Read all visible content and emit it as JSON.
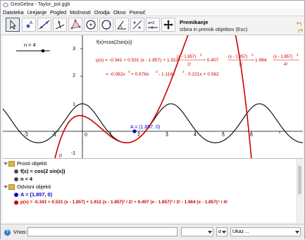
{
  "window": {
    "title": "GeoGebra - Taylor_pol.ggb"
  },
  "menu": [
    "Datoteka",
    "Urejanje",
    "Pogled",
    "Možnosti",
    "Orodja",
    "Okno",
    "Pomoč"
  ],
  "tool_info": {
    "name": "Premikanje",
    "help": "Izbira in premik objektov (Esc)"
  },
  "tools": [
    {
      "name": "move-tool",
      "active": true
    },
    {
      "name": "new-point-tool"
    },
    {
      "name": "line-tool"
    },
    {
      "name": "perpendicular-line-tool"
    },
    {
      "name": "polygon-tool"
    },
    {
      "name": "circle-tool"
    },
    {
      "name": "circle-three-points-tool"
    },
    {
      "name": "angle-tool"
    },
    {
      "name": "reflect-tool"
    },
    {
      "name": "slider-tool",
      "text": "a=2"
    },
    {
      "name": "move-graphics-view-tool"
    }
  ],
  "graphics": {
    "slider": {
      "label": "n = 4",
      "value": 4
    },
    "f_label": "f(x)=cos(2sin(x))",
    "p_formula": {
      "lead": "p(x) = -0.341 + 0.531 (x - 1.857) + 1.912 ",
      "t2_num": "(x - 1.857)",
      "t2_den": "2!",
      "plus": " + 0.407 ",
      "t3_num": "(x - 1.857)",
      "t3_den": "3!",
      "minus": " - 1.964 ",
      "t4_num": "(x - 1.857)",
      "t4_den": "4!",
      "exp2": "2",
      "exp3": "3",
      "exp4": "4",
      "expanded": "= -0.082x",
      "e4": "4",
      "expanded_b": " + 0.676x",
      "e3": "3",
      "expanded_c": " - 1.116x",
      "e2": "2",
      "expanded_d": " - 0.221x + 0.562"
    },
    "point_label": "A = (1.857, 0)",
    "p_label": "p",
    "y_ticks": [
      "3",
      "2",
      "1",
      "-1"
    ],
    "x_ticks": [
      "-2",
      "-1",
      "0",
      "1",
      "2",
      "3",
      "4",
      "5",
      "6"
    ],
    "colors": {
      "f": "#000000",
      "p": "#cc0000",
      "point": "#0000cc"
    }
  },
  "algebra": {
    "free_header": "Prosti objekti",
    "free_items": [
      "f(x) = cos(2 sin(x))",
      "n = 4"
    ],
    "dependent_header": "Odvisni objekti",
    "dependent_items": [
      "A = (1.857, 0)",
      "p(x) = -0.341 + 0.531 (x - 1.857) + 1.912 (x - 1.857)² / 2! + 0.407 (x - 1.857)³ / 3! - 1.964 (x - 1.857)⁴ / 4!"
    ]
  },
  "input_bar": {
    "help": "?",
    "label": "Vnos:",
    "value": "",
    "combo1": "",
    "combo2": "α",
    "combo3": "Ukaz ..."
  }
}
